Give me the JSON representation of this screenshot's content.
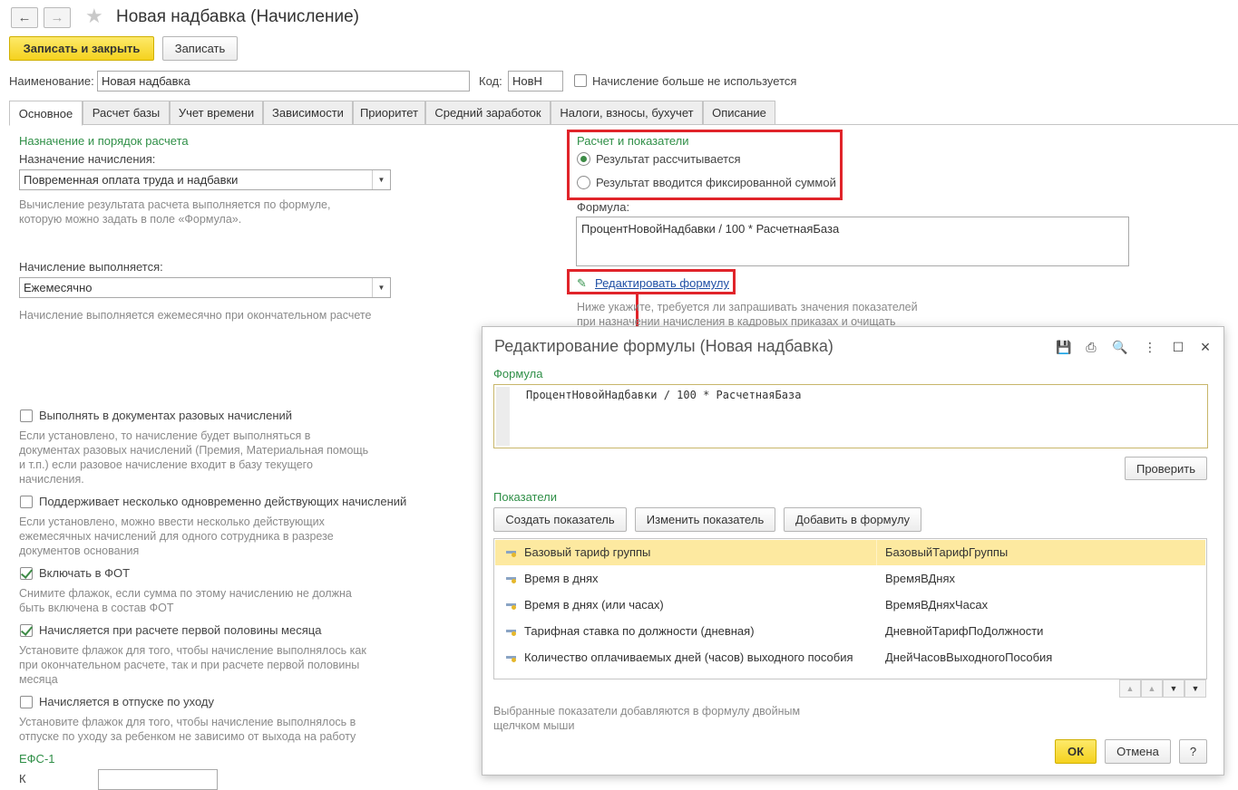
{
  "window": {
    "title": "Новая надбавка (Начисление)",
    "back_icon": "arrow-left-icon",
    "forward_icon": "arrow-right-icon",
    "favorite_icon": "star-icon"
  },
  "toolbar": {
    "save_close_label": "Записать и закрыть",
    "save_label": "Записать"
  },
  "header": {
    "name_label": "Наименование:",
    "name_value": "Новая надбавка",
    "code_label": "Код:",
    "code_value": "НовН",
    "not_used_label": "Начисление больше не используется"
  },
  "tabs": [
    {
      "label": "Основное"
    },
    {
      "label": "Расчет базы"
    },
    {
      "label": "Учет времени"
    },
    {
      "label": "Зависимости"
    },
    {
      "label": "Приоритет"
    },
    {
      "label": "Средний заработок"
    },
    {
      "label": "Налоги, взносы, бухучет"
    },
    {
      "label": "Описание"
    }
  ],
  "left": {
    "section_title": "Назначение и порядок расчета",
    "purpose_label": "Назначение начисления:",
    "purpose_value": "Повременная оплата труда и надбавки",
    "purpose_hint_1": "Вычисление результата расчета выполняется по формуле,",
    "purpose_hint_2": "которую можно задать в поле «Формула».",
    "period_label": "Начисление выполняется:",
    "period_value": "Ежемесячно",
    "period_hint": "Начисление выполняется ежемесячно при окончательном расчете",
    "cb1_label": "Выполнять в документах разовых начислений",
    "cb1_hint": [
      "Если установлено, то начисление будет выполняться в",
      "документах разовых начислений (Премия, Материальная помощь",
      "и т.п.) если разовое начисление входит в базу текущего",
      "начисления."
    ],
    "cb2_label": "Поддерживает несколько одновременно действующих начислений",
    "cb2_hint": [
      "Если установлено, можно ввести несколько действующих",
      "ежемесячных начислений для одного сотрудника в разрезе",
      "документов основания"
    ],
    "cb3_label": "Включать в ФОТ",
    "cb3_hint": [
      "Снимите флажок, если сумма по этому начислению не должна",
      "быть включена в состав ФОТ"
    ],
    "cb4_label": "Начисляется при расчете первой половины месяца",
    "cb4_hint": [
      "Установите флажок для того, чтобы начисление выполнялось как",
      "при окончательном расчете, так и при расчете первой половины",
      "месяца"
    ],
    "cb5_label": "Начисляется в отпуске по уходу",
    "cb5_hint": [
      "Установите флажок для того, чтобы начисление выполнялось в",
      "отпуске по уходу за ребенком не зависимо от выхода на работу"
    ],
    "efs_title": "ЕФС-1",
    "efs_field_label": "К"
  },
  "right": {
    "section_title": "Расчет и показатели",
    "radio1": "Результат рассчитывается",
    "radio2": "Результат вводится фиксированной суммой",
    "formula_label": "Формула:",
    "formula_value": "ПроцентНовойНадбавки / 100 * РасчетнаяБаза",
    "edit_formula_link": "Редактировать формулу",
    "pencil_icon": "pencil-icon",
    "note_1": "Ниже укажите, требуется ли запрашивать значения показателей",
    "note_2": "при назначении начисления в кадровых приказах и очищать"
  },
  "dialog": {
    "title": "Редактирование формулы (Новая надбавка)",
    "icons": [
      "save-icon",
      "print-icon",
      "preview-icon",
      "more-icon",
      "maximize-icon",
      "close-icon"
    ],
    "formula_section": "Формула",
    "formula_text": "ПроцентНовойНадбавки / 100 * РасчетнаяБаза",
    "check_button": "Проверить",
    "indicators_section": "Показатели",
    "create_button": "Создать показатель",
    "change_button": "Изменить показатель",
    "add_button": "Добавить в формулу",
    "indicators": [
      {
        "name": "Базовый тариф группы",
        "id": "БазовыйТарифГруппы"
      },
      {
        "name": "Время в днях",
        "id": "ВремяВДнях"
      },
      {
        "name": "Время в днях (или часах)",
        "id": "ВремяВДняхЧасах"
      },
      {
        "name": "Тарифная ставка по должности (дневная)",
        "id": "ДневнойТарифПоДолжности"
      },
      {
        "name": "Количество оплачиваемых дней (часов) выходного пособия",
        "id": "ДнейЧасовВыходногоПособия"
      }
    ],
    "hint_1": "Выбранные показатели добавляются в формулу двойным",
    "hint_2": "щелчком мыши",
    "ok_button": "ОК",
    "cancel_button": "Отмена",
    "help_button": "?"
  },
  "colors": {
    "accent_green": "#2f8f47",
    "highlight_red": "#e0242a",
    "primary_yellow": "#f5d21e",
    "selection_row": "#fde9a0",
    "link_blue": "#1f4fa5"
  }
}
